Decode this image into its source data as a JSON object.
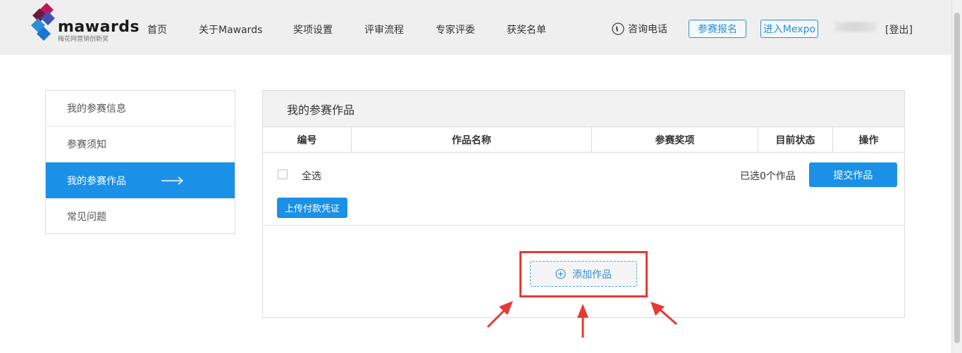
{
  "header": {
    "logo_text": "mawards",
    "logo_subtitle": "梅花网营销创新奖",
    "nav": [
      "首页",
      "关于Mawards",
      "奖项设置",
      "评审流程",
      "专家评委",
      "获奖名单"
    ],
    "hotline_label": "咨询电话",
    "register_button": "参赛报名",
    "mexpo_button": "进入Mexpo",
    "logout_label": "[登出]"
  },
  "sidebar": {
    "items": [
      {
        "label": "我的参赛信息",
        "active": false
      },
      {
        "label": "参赛须知",
        "active": false
      },
      {
        "label": "我的参赛作品",
        "active": true
      },
      {
        "label": "常见问题",
        "active": false
      }
    ]
  },
  "main": {
    "title": "我的参赛作品",
    "columns": [
      "编号",
      "作品名称",
      "参赛奖项",
      "目前状态",
      "操作"
    ],
    "select_all_label": "全选",
    "selected_count_label": "已选0个作品",
    "submit_button": "提交作品",
    "upload_button": "上传付款凭证",
    "add_work_button": "添加作品"
  },
  "colors": {
    "accent": "#1a91e6",
    "header_bg": "#efefef",
    "highlight": "#e53935"
  }
}
